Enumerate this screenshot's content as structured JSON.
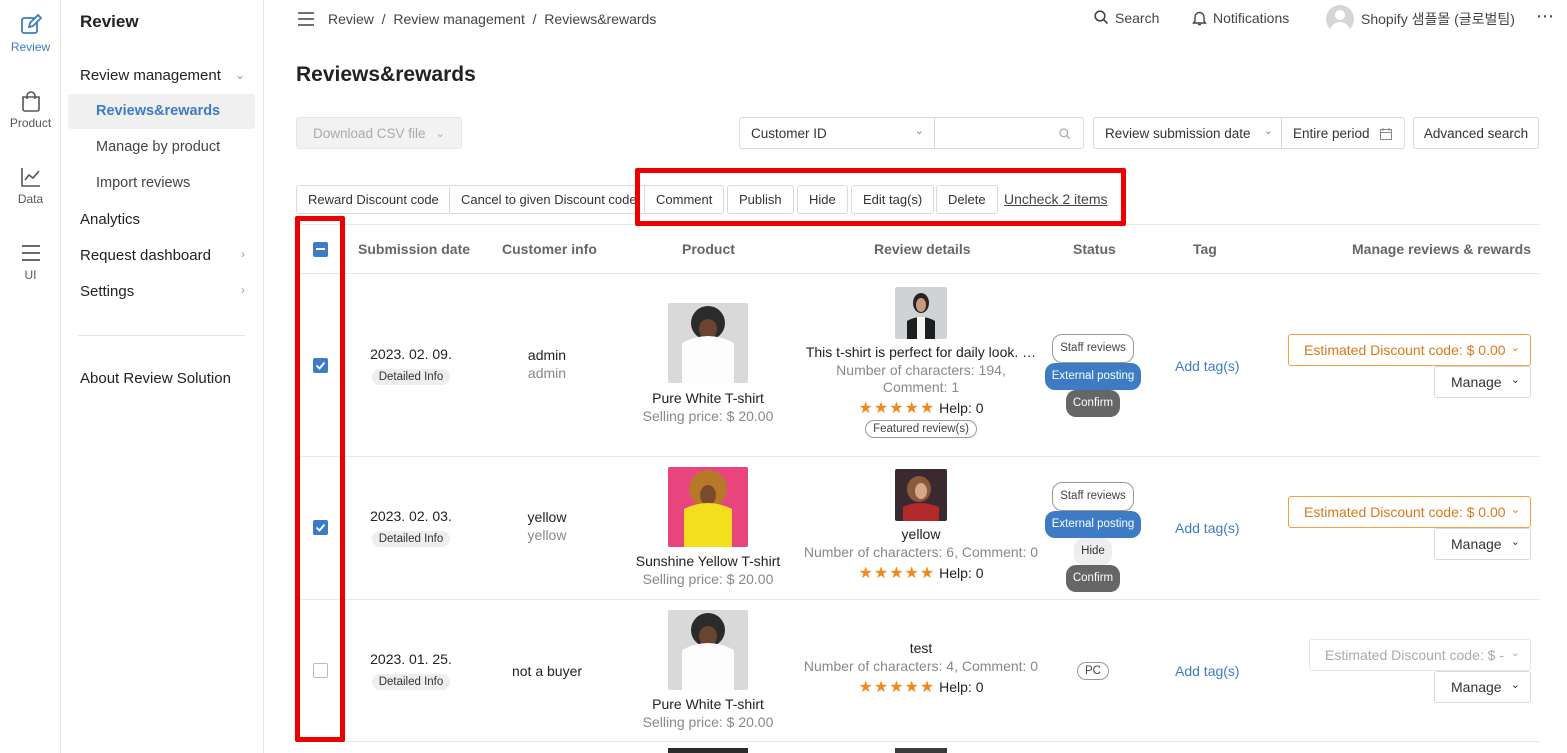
{
  "rail": [
    {
      "label": "Review",
      "icon": "edit-icon",
      "active": true
    },
    {
      "label": "Product",
      "icon": "bag-icon"
    },
    {
      "label": "Data",
      "icon": "chart-icon"
    },
    {
      "label": "UI",
      "icon": "menu-icon"
    }
  ],
  "sidebar": {
    "title": "Review",
    "items": [
      {
        "label": "Review management"
      },
      {
        "label": "Reviews&rewards"
      },
      {
        "label": "Manage by product"
      },
      {
        "label": "Import reviews"
      },
      {
        "label": "Analytics"
      },
      {
        "label": "Request dashboard"
      },
      {
        "label": "Settings"
      },
      {
        "label": "About Review Solution"
      }
    ]
  },
  "header": {
    "breadcrumb": "Review  /  Review management  /  Reviews&rewards",
    "search": "Search",
    "notifications": "Notifications",
    "user": "Shopify 샘플몰 (글로벌팀)"
  },
  "page": {
    "title": "Reviews&rewards"
  },
  "toolbar": {
    "download_csv": "Download CSV file",
    "customer_select": "Customer ID",
    "search_placeholder": "",
    "date_type": "Review submission date",
    "period": "Entire period",
    "advanced": "Advanced search"
  },
  "actions": {
    "reward": "Reward Discount code",
    "cancel": "Cancel to given Discount code",
    "comment": "Comment",
    "publish": "Publish",
    "hide": "Hide",
    "edit_tags": "Edit tag(s)",
    "delete": "Delete",
    "uncheck": "Uncheck 2 items"
  },
  "table": {
    "headers": [
      "Submission date",
      "Customer info",
      "Product",
      "Review details",
      "Status",
      "Tag",
      "Manage reviews & rewards"
    ],
    "rows": [
      {
        "checked": true,
        "date": "2023. 02. 09.",
        "detail": "Detailed Info",
        "customer": "admin",
        "customer_sub": "admin",
        "product": "Pure White T-shirt",
        "price": "Selling price: $ 20.00",
        "review_title": "This t-shirt is perfect for daily look. …",
        "review_meta1": "Number of characters: 194,",
        "review_meta2": "Comment: 1",
        "stars": "★★★★★",
        "help": "Help: 0",
        "featured": "Featured review(s)",
        "status": [
          "Staff reviews",
          "External posting",
          "Confirm"
        ],
        "tag": "Add tag(s)",
        "estimate": "Estimated Discount code: $ 0.00",
        "manage": "Manage"
      },
      {
        "checked": true,
        "date": "2023. 02. 03.",
        "detail": "Detailed Info",
        "customer": "yellow",
        "customer_sub": "yellow",
        "product": "Sunshine Yellow T-shirt",
        "price": "Selling price: $ 20.00",
        "review_title": "yellow",
        "review_meta1": "Number of characters: 6, Comment: 0",
        "stars": "★★★★★",
        "help": "Help: 0",
        "status": [
          "Staff reviews",
          "External posting",
          "Hide",
          "Confirm"
        ],
        "tag": "Add tag(s)",
        "estimate": "Estimated Discount code: $ 0.00",
        "manage": "Manage"
      },
      {
        "checked": false,
        "date": "2023. 01. 25.",
        "detail": "Detailed Info",
        "customer": "not a buyer",
        "product": "Pure White T-shirt",
        "price": "Selling price: $ 20.00",
        "review_title": "test",
        "review_meta1": "Number of characters: 4, Comment: 0",
        "stars": "★★★★★",
        "help": "Help: 0",
        "status": [
          "PC"
        ],
        "tag": "Add tag(s)",
        "estimate": "Estimated Discount code: $ -",
        "manage": "Manage"
      }
    ]
  },
  "colors": {
    "accent": "#3d7cc4",
    "highlight": "#e00000",
    "discount": "#d9781a",
    "star": "#f08a1c"
  }
}
